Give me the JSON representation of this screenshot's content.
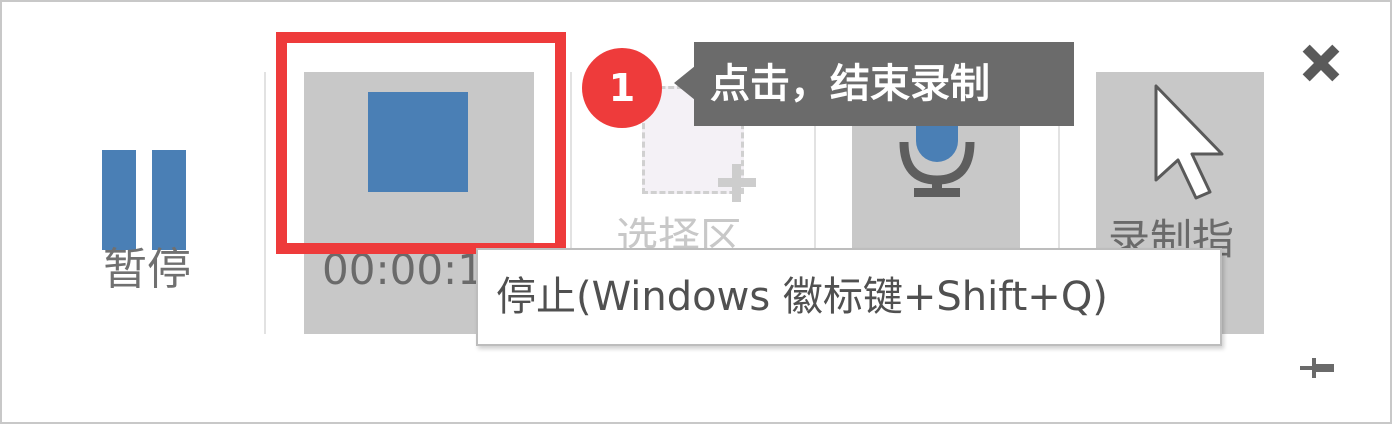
{
  "toolbar": {
    "pause": {
      "label": "暂停",
      "icon": "pause-icon"
    },
    "stop": {
      "timer": "00:00:1",
      "icon": "stop-icon"
    },
    "select_area": {
      "label": "选择区",
      "icon": "select-area-icon"
    },
    "audio": {
      "icon": "microphone-icon"
    },
    "record_pointer": {
      "label": "录制指",
      "icon": "cursor-pointer-icon"
    },
    "close_icon": "close-icon",
    "pin_icon": "pin-icon"
  },
  "annotation": {
    "step_number": "1",
    "callout_text": "点击，结束录制",
    "highlight_color": "#ee3b3b"
  },
  "tooltip": {
    "text": "停止(Windows 徽标键+Shift+Q)"
  },
  "colors": {
    "accent_blue": "#4a7fb5",
    "button_active_bg": "#c8c8c8",
    "callout_bg": "#6b6b6b"
  }
}
